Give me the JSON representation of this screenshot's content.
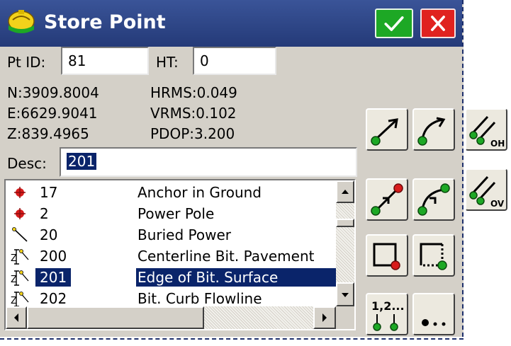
{
  "window": {
    "title": "Store Point"
  },
  "form": {
    "pt_id_label": "Pt ID:",
    "pt_id_value": "81",
    "ht_label": "HT:",
    "ht_value": "0",
    "northing": "N:3909.8004",
    "easting": "E:6629.9041",
    "elevation": "Z:839.4965",
    "hrms": "HRMS:0.049",
    "vrms": "VRMS:0.102",
    "pdop": "PDOP:3.200",
    "desc_label": "Desc:",
    "desc_value": "201"
  },
  "codes": [
    {
      "num": "17",
      "desc": "Anchor in Ground",
      "icon": "red-dot-icon"
    },
    {
      "num": "2",
      "desc": "Power Pole",
      "icon": "red-dot-icon"
    },
    {
      "num": "20",
      "desc": "Buried Power",
      "icon": "line-icon"
    },
    {
      "num": "200",
      "desc": "Centerline Bit. Pavement",
      "icon": "pavement-icon"
    },
    {
      "num": "201",
      "desc": "Edge of Bit. Surface",
      "icon": "pavement-icon",
      "selected": true
    },
    {
      "num": "202",
      "desc": "Bit. Curb Flowline",
      "icon": "pavement-icon"
    }
  ],
  "tools": {
    "offset_label_top": "OH",
    "offset_label_bottom": "OV",
    "sequence_label": "1,2..."
  },
  "colors": {
    "title_bg": "#2f4a8a",
    "ok": "#1da825",
    "cancel": "#e0221f",
    "selection": "#0a246a"
  }
}
